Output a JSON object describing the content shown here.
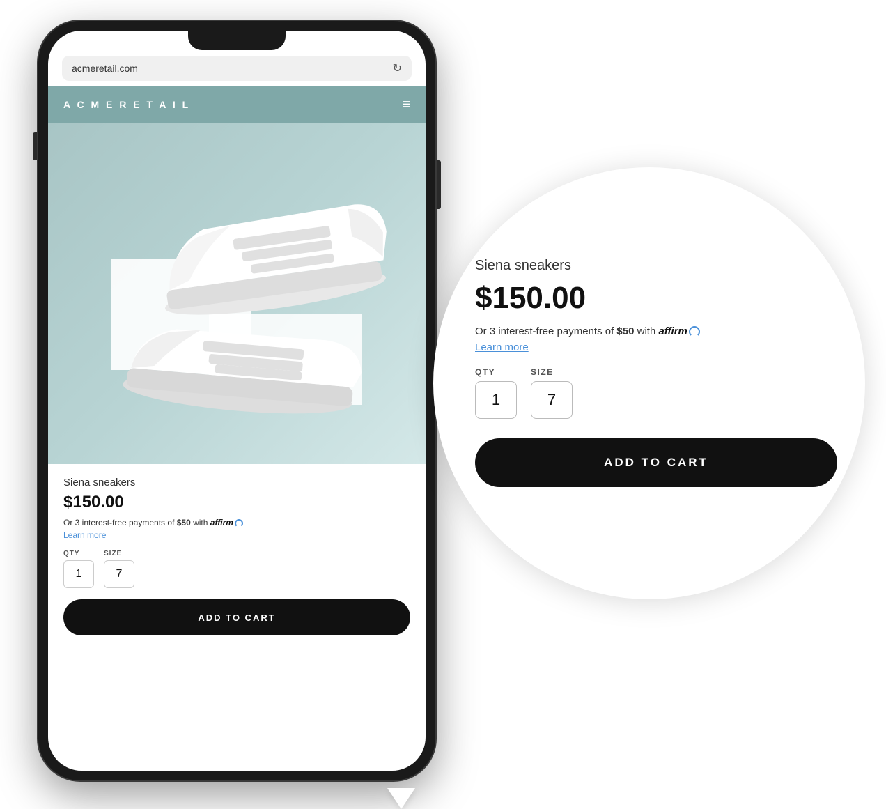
{
  "browser": {
    "url": "acmeretail.com",
    "reload_icon": "↻"
  },
  "header": {
    "logo": "A C M E   R E T A I L",
    "menu_icon": "≡"
  },
  "product": {
    "name": "Siena sneakers",
    "price": "$150.00",
    "affirm_text_prefix": "Or 3 interest-free payments of ",
    "affirm_amount": "$50",
    "affirm_text_suffix": " with ",
    "affirm_brand": "affirm",
    "learn_more": "Learn more",
    "qty_label": "QTY",
    "size_label": "SIZE",
    "qty_value": "1",
    "size_value": "7",
    "add_to_cart": "ADD TO CART"
  },
  "zoom": {
    "product_name": "Siena sneakers",
    "price": "$150.00",
    "affirm_text_prefix": "Or 3 interest-free payments of ",
    "affirm_amount": "$50",
    "affirm_text_suffix": " with ",
    "affirm_brand": "affirm",
    "learn_more": "Learn more",
    "qty_label": "QTY",
    "size_label": "SIZE",
    "qty_value": "1",
    "size_value": "7",
    "add_to_cart": "ADD TO CART"
  }
}
